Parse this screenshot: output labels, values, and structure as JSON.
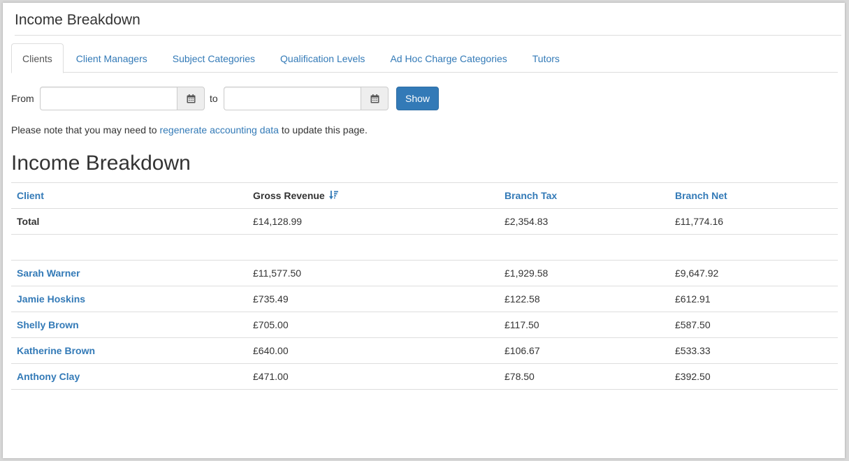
{
  "page": {
    "title": "Income Breakdown"
  },
  "tabs": [
    {
      "label": "Clients",
      "active": true
    },
    {
      "label": "Client Managers"
    },
    {
      "label": "Subject Categories"
    },
    {
      "label": "Qualification Levels"
    },
    {
      "label": "Ad Hoc Charge Categories"
    },
    {
      "label": "Tutors"
    }
  ],
  "filter": {
    "from_label": "From",
    "to_label": "to",
    "from_value": "",
    "to_value": "",
    "show_label": "Show",
    "calendar_icon": "calendar-icon"
  },
  "note": {
    "before": "Please note that you may need to ",
    "link": "regenerate accounting data",
    "after": " to update this page."
  },
  "section": {
    "title": "Income Breakdown"
  },
  "table": {
    "headers": {
      "client": "Client",
      "gross_revenue": "Gross Revenue",
      "branch_tax": "Branch Tax",
      "branch_net": "Branch Net"
    },
    "sort_icon": "sort-descending-icon",
    "total": {
      "label": "Total",
      "gross": "£14,128.99",
      "tax": "£2,354.83",
      "net": "£11,774.16"
    },
    "rows": [
      {
        "client": "Sarah Warner",
        "gross": "£11,577.50",
        "tax": "£1,929.58",
        "net": "£9,647.92"
      },
      {
        "client": "Jamie Hoskins",
        "gross": "£735.49",
        "tax": "£122.58",
        "net": "£612.91"
      },
      {
        "client": "Shelly Brown",
        "gross": "£705.00",
        "tax": "£117.50",
        "net": "£587.50"
      },
      {
        "client": "Katherine Brown",
        "gross": "£640.00",
        "tax": "£106.67",
        "net": "£533.33"
      },
      {
        "client": "Anthony Clay",
        "gross": "£471.00",
        "tax": "£78.50",
        "net": "£392.50"
      }
    ]
  },
  "colors": {
    "link": "#337ab7",
    "button": "#337ab7",
    "border": "#dddddd"
  }
}
